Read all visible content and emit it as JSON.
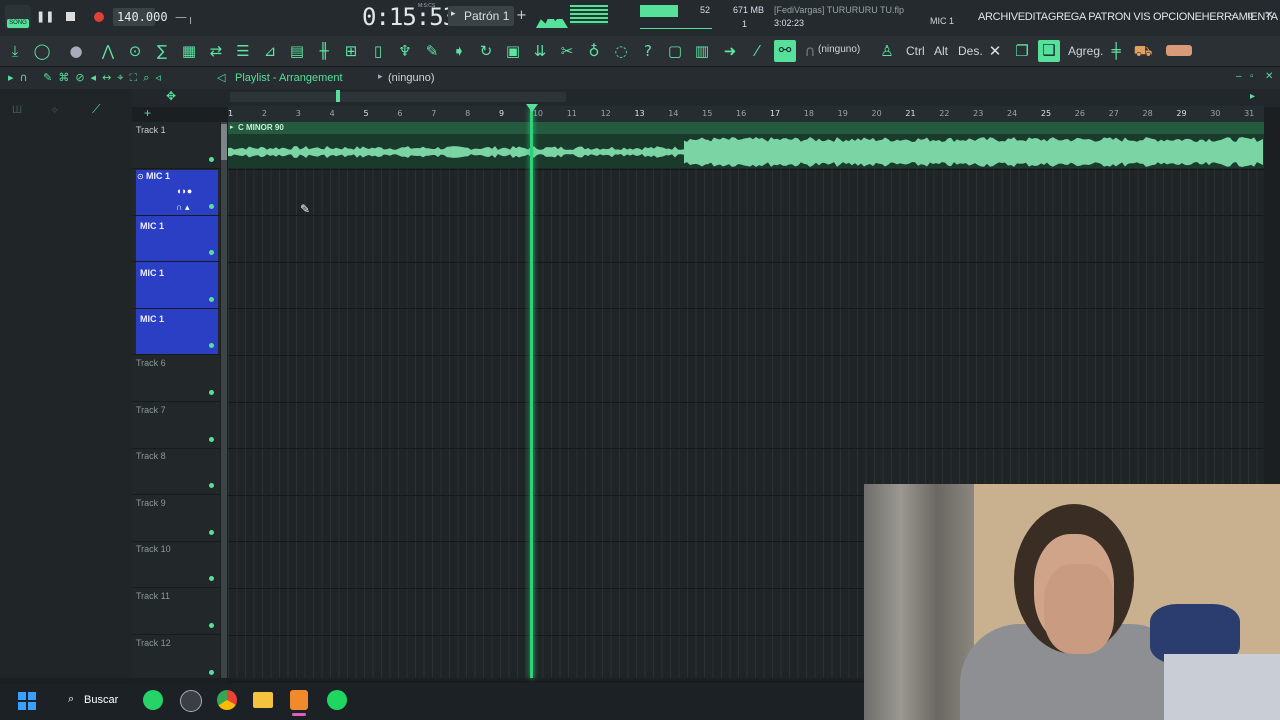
{
  "app": {
    "song_mode_label": "SONG",
    "tempo": "140.000",
    "time": "0:15:53",
    "time_unit": "M:S:CS",
    "pattern": "Patrón 1",
    "cpu": "52",
    "memory": "671 MB",
    "poly": "1",
    "project_title": "[FediVargas] TURURURU TU.flp",
    "project_time": "3:02:23",
    "channel_hint": "MIC 1",
    "menu": [
      "ARCHIV",
      "EDITA",
      "GREGA",
      "PATRON",
      "VIS",
      "OPCIONE",
      "HERRAMIENTA"
    ]
  },
  "toolbar": {
    "snap_label": "(ninguno)",
    "ctrl_label": "Ctrl",
    "alt_label": "Alt",
    "des_label": "Des.",
    "agreg_label": "Agreg."
  },
  "playlist": {
    "title": "Playlist - Arrangement",
    "snap": "(ninguno)",
    "ruler": [
      "1",
      "2",
      "3",
      "4",
      "5",
      "6",
      "7",
      "8",
      "9",
      "10",
      "11",
      "12",
      "13",
      "14",
      "15",
      "16",
      "17",
      "18",
      "19",
      "20",
      "21",
      "22",
      "23",
      "24",
      "25",
      "26",
      "27",
      "28",
      "29",
      "30",
      "31"
    ],
    "clip_name": "C MINOR 90",
    "tracks": [
      "Track 1",
      "MIC 1",
      "MIC 1",
      "MIC 1",
      "MIC 1",
      "Track 6",
      "Track 7",
      "Track 8",
      "Track 9",
      "Track 10",
      "Track 11",
      "Track 12"
    ]
  },
  "taskbar": {
    "search_label": "Buscar"
  },
  "colors": {
    "accent": "#56e09a",
    "selection": "#2a3fc4",
    "playhead": "#2fd27a"
  }
}
